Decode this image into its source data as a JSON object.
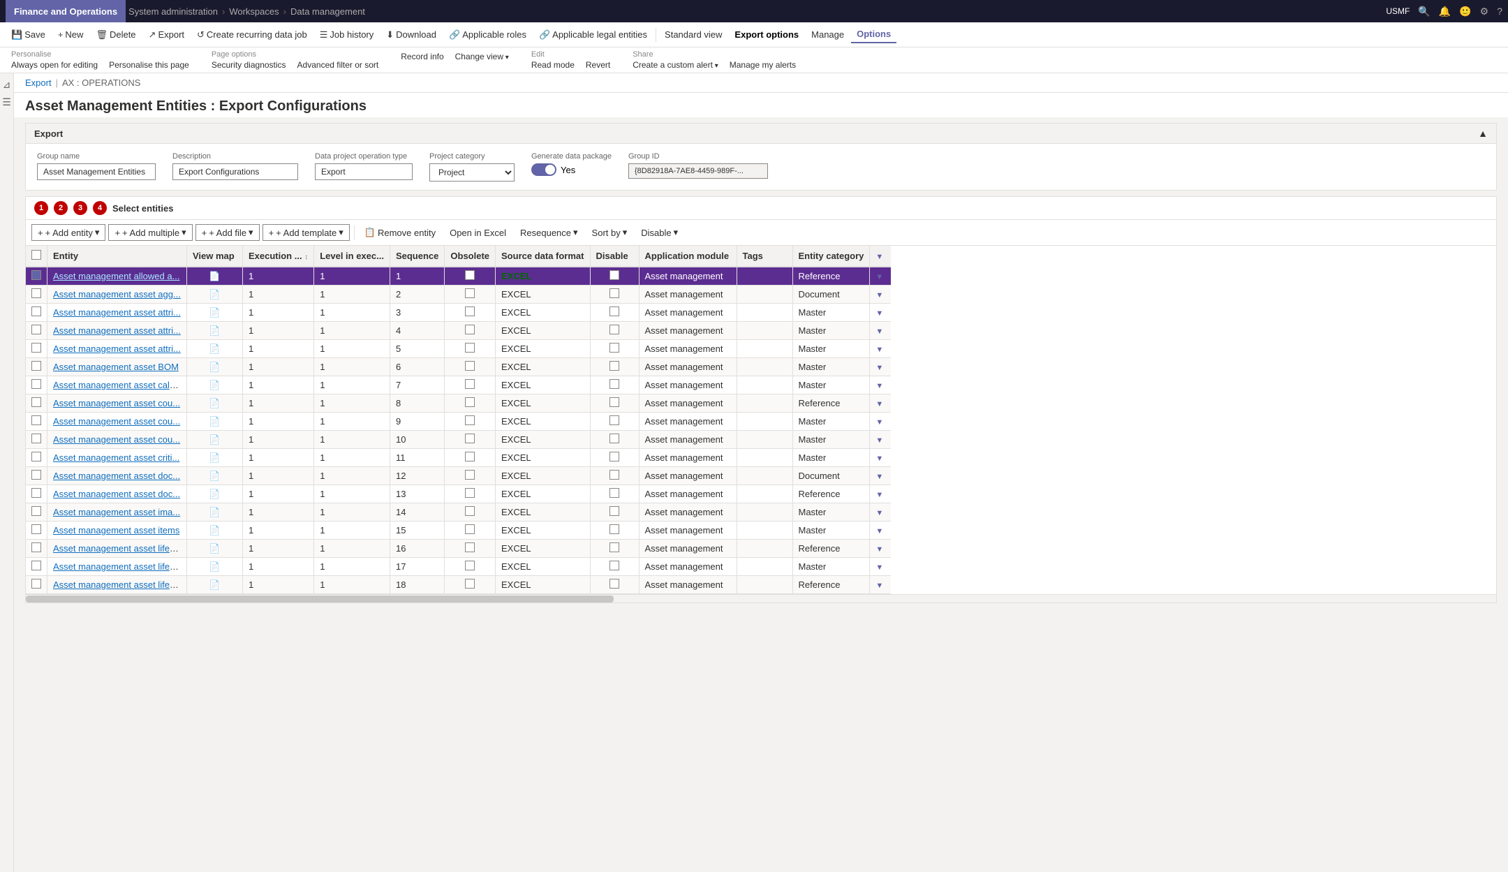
{
  "topNav": {
    "brand": "Finance and Operations",
    "breadcrumb": [
      "System administration",
      "Workspaces",
      "Data management"
    ],
    "userLabel": "USMF"
  },
  "actionBar": {
    "buttons": [
      {
        "id": "save",
        "icon": "💾",
        "label": "Save"
      },
      {
        "id": "new",
        "icon": "+",
        "label": "New"
      },
      {
        "id": "delete",
        "icon": "🗑",
        "label": "Delete"
      },
      {
        "id": "export",
        "icon": "↗",
        "label": "Export"
      },
      {
        "id": "recurring",
        "icon": "↺",
        "label": "Create recurring data job"
      },
      {
        "id": "jobhistory",
        "icon": "☰",
        "label": "Job history"
      },
      {
        "id": "download",
        "icon": "⬇",
        "label": "Download"
      },
      {
        "id": "applicable-roles",
        "icon": "🔗",
        "label": "Applicable roles"
      },
      {
        "id": "applicable-legal",
        "icon": "🔗",
        "label": "Applicable legal entities"
      },
      {
        "id": "standard-view",
        "icon": "",
        "label": "Standard view"
      },
      {
        "id": "export-options",
        "icon": "",
        "label": "Export options"
      },
      {
        "id": "manage",
        "icon": "",
        "label": "Manage"
      },
      {
        "id": "options",
        "icon": "",
        "label": "Options"
      }
    ]
  },
  "optionsBar": {
    "groups": [
      {
        "title": "Personalise",
        "items": [
          {
            "label": "Always open for editing",
            "hasArrow": false
          },
          {
            "label": "Personalise this page",
            "hasArrow": false
          }
        ]
      },
      {
        "title": "Page options",
        "items": [
          {
            "label": "Security diagnostics",
            "hasArrow": false
          },
          {
            "label": "Advanced filter or sort",
            "hasArrow": false
          }
        ]
      },
      {
        "title": "",
        "items": [
          {
            "label": "Record info",
            "hasArrow": false
          },
          {
            "label": "Change view",
            "hasArrow": true
          }
        ]
      },
      {
        "title": "Edit",
        "items": [
          {
            "label": "Read mode",
            "hasArrow": false
          },
          {
            "label": "Revert",
            "hasArrow": false
          }
        ]
      },
      {
        "title": "Share",
        "items": [
          {
            "label": "Create a custom alert",
            "hasArrow": true
          },
          {
            "label": "Manage my alerts",
            "hasArrow": false
          }
        ]
      }
    ]
  },
  "breadcrumb": {
    "items": [
      "Export",
      "AX : OPERATIONS"
    ]
  },
  "pageTitle": "Asset Management Entities : Export Configurations",
  "exportSection": {
    "title": "Export",
    "fields": {
      "groupNameLabel": "Group name",
      "groupNameValue": "Asset Management Entities",
      "descriptionLabel": "Description",
      "descriptionValue": "Export Configurations",
      "dataProjectLabel": "Data project operation type",
      "dataProjectValue": "Export",
      "projectCategoryLabel": "Project category",
      "projectCategoryValue": "Project",
      "generatePackageLabel": "Generate data package",
      "generatePackageValue": "Yes",
      "groupIdLabel": "Group ID",
      "groupIdValue": "{8D82918A-7AE8-4459-989F-..."
    }
  },
  "entitiesSection": {
    "title": "Select entities",
    "steps": [
      1,
      2,
      3,
      4
    ],
    "toolbar": {
      "addEntity": "+ Add entity",
      "addMultiple": "+ Add multiple",
      "addFile": "+ Add file",
      "addTemplate": "+ Add template",
      "removeEntity": "Remove entity",
      "openInExcel": "Open in Excel",
      "resequence": "Resequence",
      "sortBy": "Sort by",
      "disable": "Disable"
    },
    "columns": [
      {
        "id": "entity",
        "label": "Entity"
      },
      {
        "id": "viewmap",
        "label": "View map"
      },
      {
        "id": "execution",
        "label": "Execution ..."
      },
      {
        "id": "level",
        "label": "Level in exec..."
      },
      {
        "id": "sequence",
        "label": "Sequence"
      },
      {
        "id": "obsolete",
        "label": "Obsolete"
      },
      {
        "id": "source",
        "label": "Source data format"
      },
      {
        "id": "disable",
        "label": "Disable"
      },
      {
        "id": "appmod",
        "label": "Application module"
      },
      {
        "id": "tags",
        "label": "Tags"
      },
      {
        "id": "entcat",
        "label": "Entity category"
      },
      {
        "id": "filter",
        "label": "Fil"
      }
    ],
    "rows": [
      {
        "entity": "Asset management allowed a...",
        "viewmap": true,
        "execution": 1,
        "level": 1,
        "sequence": 1,
        "obsolete": false,
        "source": "EXCEL",
        "sourceLink": true,
        "disable": false,
        "appmod": "Asset management",
        "tags": "",
        "entcat": "Reference",
        "selected": true
      },
      {
        "entity": "Asset management asset agg...",
        "viewmap": true,
        "execution": 1,
        "level": 1,
        "sequence": 2,
        "obsolete": false,
        "source": "EXCEL",
        "sourceLink": false,
        "disable": false,
        "appmod": "Asset management",
        "tags": "",
        "entcat": "Document",
        "selected": false
      },
      {
        "entity": "Asset management asset attri...",
        "viewmap": true,
        "execution": 1,
        "level": 1,
        "sequence": 3,
        "obsolete": false,
        "source": "EXCEL",
        "sourceLink": false,
        "disable": false,
        "appmod": "Asset management",
        "tags": "",
        "entcat": "Master",
        "selected": false
      },
      {
        "entity": "Asset management asset attri...",
        "viewmap": true,
        "execution": 1,
        "level": 1,
        "sequence": 4,
        "obsolete": false,
        "source": "EXCEL",
        "sourceLink": false,
        "disable": false,
        "appmod": "Asset management",
        "tags": "",
        "entcat": "Master",
        "selected": false
      },
      {
        "entity": "Asset management asset attri...",
        "viewmap": true,
        "execution": 1,
        "level": 1,
        "sequence": 5,
        "obsolete": false,
        "source": "EXCEL",
        "sourceLink": false,
        "disable": false,
        "appmod": "Asset management",
        "tags": "",
        "entcat": "Master",
        "selected": false
      },
      {
        "entity": "Asset management asset BOM",
        "viewmap": true,
        "execution": 1,
        "level": 1,
        "sequence": 6,
        "obsolete": false,
        "source": "EXCEL",
        "sourceLink": false,
        "disable": false,
        "appmod": "Asset management",
        "tags": "",
        "entcat": "Master",
        "selected": false
      },
      {
        "entity": "Asset management asset cale...",
        "viewmap": true,
        "execution": 1,
        "level": 1,
        "sequence": 7,
        "obsolete": false,
        "source": "EXCEL",
        "sourceLink": false,
        "disable": false,
        "appmod": "Asset management",
        "tags": "",
        "entcat": "Master",
        "selected": false
      },
      {
        "entity": "Asset management asset cou...",
        "viewmap": true,
        "execution": 1,
        "level": 1,
        "sequence": 8,
        "obsolete": false,
        "source": "EXCEL",
        "sourceLink": false,
        "disable": false,
        "appmod": "Asset management",
        "tags": "",
        "entcat": "Reference",
        "selected": false
      },
      {
        "entity": "Asset management asset cou...",
        "viewmap": true,
        "execution": 1,
        "level": 1,
        "sequence": 9,
        "obsolete": false,
        "source": "EXCEL",
        "sourceLink": false,
        "disable": false,
        "appmod": "Asset management",
        "tags": "",
        "entcat": "Master",
        "selected": false
      },
      {
        "entity": "Asset management asset cou...",
        "viewmap": true,
        "execution": 1,
        "level": 1,
        "sequence": 10,
        "obsolete": false,
        "source": "EXCEL",
        "sourceLink": false,
        "disable": false,
        "appmod": "Asset management",
        "tags": "",
        "entcat": "Master",
        "selected": false
      },
      {
        "entity": "Asset management asset criti...",
        "viewmap": true,
        "execution": 1,
        "level": 1,
        "sequence": 11,
        "obsolete": false,
        "source": "EXCEL",
        "sourceLink": false,
        "disable": false,
        "appmod": "Asset management",
        "tags": "",
        "entcat": "Master",
        "selected": false
      },
      {
        "entity": "Asset management asset doc...",
        "viewmap": true,
        "execution": 1,
        "level": 1,
        "sequence": 12,
        "obsolete": false,
        "source": "EXCEL",
        "sourceLink": false,
        "disable": false,
        "appmod": "Asset management",
        "tags": "",
        "entcat": "Document",
        "selected": false
      },
      {
        "entity": "Asset management asset doc...",
        "viewmap": true,
        "execution": 1,
        "level": 1,
        "sequence": 13,
        "obsolete": false,
        "source": "EXCEL",
        "sourceLink": false,
        "disable": false,
        "appmod": "Asset management",
        "tags": "",
        "entcat": "Reference",
        "selected": false
      },
      {
        "entity": "Asset management asset ima...",
        "viewmap": true,
        "execution": 1,
        "level": 1,
        "sequence": 14,
        "obsolete": false,
        "source": "EXCEL",
        "sourceLink": false,
        "disable": false,
        "appmod": "Asset management",
        "tags": "",
        "entcat": "Master",
        "selected": false
      },
      {
        "entity": "Asset management asset items",
        "viewmap": true,
        "execution": 1,
        "level": 1,
        "sequence": 15,
        "obsolete": false,
        "source": "EXCEL",
        "sourceLink": false,
        "disable": false,
        "appmod": "Asset management",
        "tags": "",
        "entcat": "Master",
        "selected": false
      },
      {
        "entity": "Asset management asset lifec...",
        "viewmap": true,
        "execution": 1,
        "level": 1,
        "sequence": 16,
        "obsolete": false,
        "source": "EXCEL",
        "sourceLink": false,
        "disable": false,
        "appmod": "Asset management",
        "tags": "",
        "entcat": "Reference",
        "selected": false
      },
      {
        "entity": "Asset management asset lifec...",
        "viewmap": true,
        "execution": 1,
        "level": 1,
        "sequence": 17,
        "obsolete": false,
        "source": "EXCEL",
        "sourceLink": false,
        "disable": false,
        "appmod": "Asset management",
        "tags": "",
        "entcat": "Master",
        "selected": false
      },
      {
        "entity": "Asset management asset lifec...",
        "viewmap": true,
        "execution": 1,
        "level": 1,
        "sequence": 18,
        "obsolete": false,
        "source": "EXCEL",
        "sourceLink": false,
        "disable": false,
        "appmod": "Asset management",
        "tags": "",
        "entcat": "Reference",
        "selected": false
      }
    ]
  }
}
